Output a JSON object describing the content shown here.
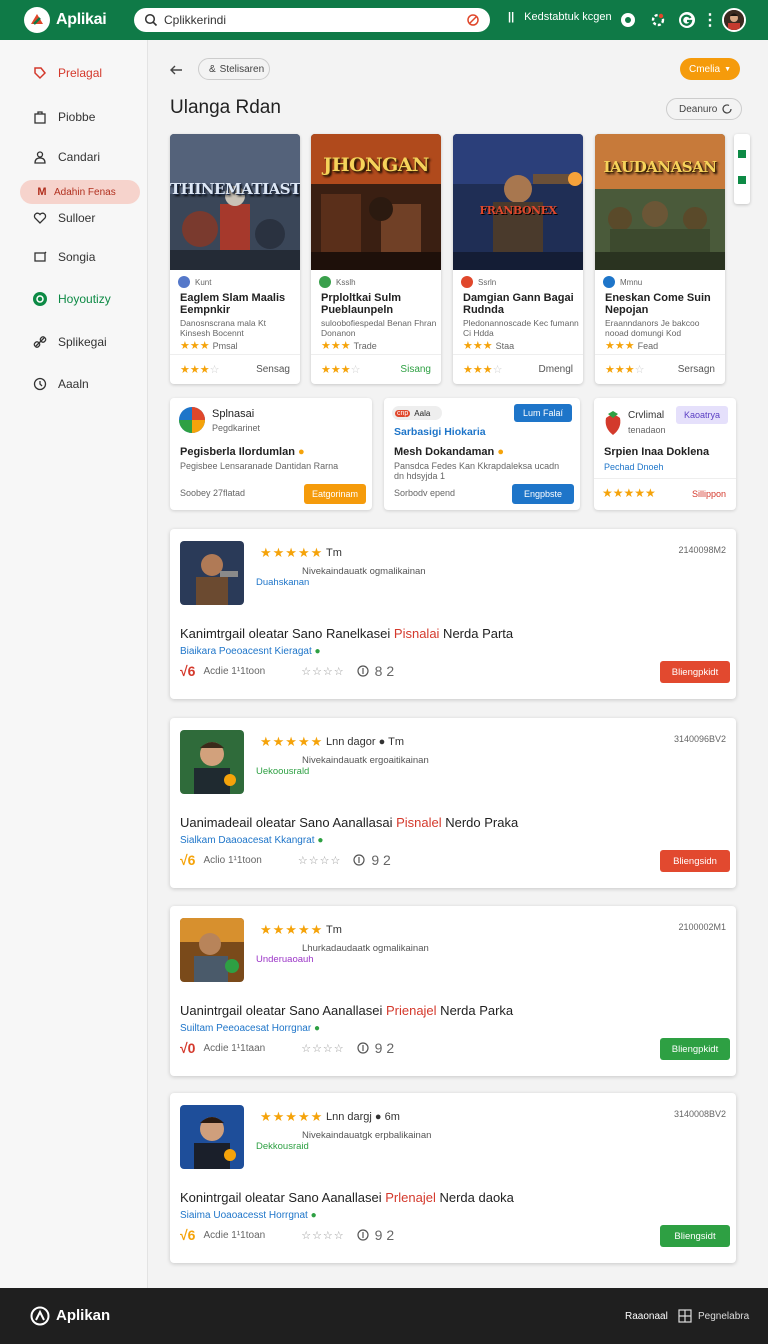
{
  "header": {
    "app_name": "Aplikai",
    "search_value": "Cplikkerindi",
    "account_text": "Kedstabtuk kcgen"
  },
  "sidebar": {
    "items": [
      {
        "label": "Prelagal",
        "icon": "tag-icon"
      },
      {
        "label": "Piobbe",
        "icon": "bag-icon"
      },
      {
        "label": "Candari",
        "icon": "person-icon"
      },
      {
        "label": "Adahin Fenas",
        "icon": "m-logo-icon"
      },
      {
        "label": "Sulloer",
        "icon": "heart-icon"
      },
      {
        "label": "Songia",
        "icon": "screen-icon"
      },
      {
        "label": "Hoyoutizy",
        "icon": "circle-icon"
      },
      {
        "label": "Splikegai",
        "icon": "link-icon"
      },
      {
        "label": "Aaaln",
        "icon": "clock-icon"
      }
    ]
  },
  "toolbar": {
    "chip_label": "Stelisaren",
    "orange_label": "Cmelia",
    "heading": "Ulanga Rdan",
    "sort_label": "Deanuro"
  },
  "games": [
    {
      "art": "THINEMATIAST",
      "dev": "Kunt",
      "name": "Eaglem Slam Maalis Eempnkir",
      "desc": "Danosnscrana mala Kt Kinsesh Bocennt",
      "rating_text": "Pmsal",
      "footer_label": "Sensag"
    },
    {
      "art": "JHONGAN",
      "dev": "Ksslh",
      "name": "Prploltkai Sulm Pueblaunpeln",
      "desc": "suloobofiespedal Benan Fhran Donanon",
      "rating_text": "Trade",
      "footer_label": "Sisang"
    },
    {
      "art": "FRANBONEX",
      "dev": "Ssrln",
      "name": "Damgian Gann Bagai Rudnda",
      "desc": "Pledonannoscade Kec fumann Ci Hdda",
      "rating_text": "Staa",
      "footer_label": "Dmengl"
    },
    {
      "art": "IAUDANASAN",
      "dev": "Mmnu",
      "name": "Eneskan Come Suin Nepojan",
      "desc": "Eraanndanors Je bakcoo nooad domungi Kod",
      "rating_text": "Fead",
      "footer_label": "Sersagn"
    }
  ],
  "promos": [
    {
      "title": "Splnasai",
      "sub": "Pegdkarinet",
      "name": "Pegisberla Ilordumlan",
      "desc": "Pegisbee Lensaranade Dantidan Rarna",
      "foot": "Soobey 27flatad",
      "button": "Eatgorinam"
    },
    {
      "badge": "Aala",
      "title": "Sarbasigi Hiokaria",
      "name": "Mesh Dokandaman",
      "desc": "Pansdca Fedes Kan Kkrapdaleksa ucadn dn hdsyjda 1",
      "foot": "Sorbodv epend",
      "button": "Engpbste",
      "corner_button": "Lum Falaí"
    },
    {
      "title": "Crvlimal",
      "sub": "tenadaon",
      "badge": "Kaoatrya",
      "name": "Srpien Inaa Doklena",
      "link": "Pechad Dnoeh",
      "foot": "Sillippon"
    }
  ],
  "reviews": [
    {
      "stars_after": "Tm",
      "date": "2140098M2",
      "sub": "Nivekaindauatk ogmalikainan",
      "tag": "Duahskanan",
      "title_a": "Kanimtrgail oleatar Sano Ranelkasei ",
      "title_red": "Pisnalai",
      "title_b": " Nerda Parta",
      "link": "Biaikara Poeoacesnt Kieragat",
      "lead": "√6",
      "age": "Acdie 1¹1toon",
      "count": "8 2",
      "button": "Bliengpkidt",
      "button_color": "#e2492f",
      "tag_color": "#1e75c9",
      "lead_color": "#d4392c"
    },
    {
      "stars_after": "Lnn dagor ● Tm",
      "date": "3140096BV2",
      "sub": "Nivekaindauatk ergoaitikainan",
      "tag": "Uekoousrald",
      "title_a": "Uanimadeail oleatar Sano Aanallasai ",
      "title_red": "Pisnalel",
      "title_b": " Nerdo Praka",
      "link": "Sialkam Daaoacesat Kkangrat",
      "lead": "√6",
      "age": "Aclio 1¹1toon",
      "count": "9 2",
      "button": "Bliengsidn",
      "button_color": "#e2492f",
      "tag_color": "#2ea043",
      "lead_color": "#f5a30a"
    },
    {
      "stars_after": "Tm",
      "date": "2100002M1",
      "sub": "Lhurkadaudaatk ogmalikainan",
      "tag": "Underuaoauh",
      "title_a": "Uanintrgail oleatar Sano Aanallasei ",
      "title_red": "Prienajel",
      "title_b": " Nerda Parka",
      "link": "Suiltam Peeoacesat Horrgnar",
      "lead": "√0",
      "age": "Acdie 1¹1taan",
      "count": "9 2",
      "button": "Bliengpkidt",
      "button_color": "#2ea043",
      "tag_color": "#9b35c7",
      "lead_color": "#d4392c"
    },
    {
      "stars_after": "Lnn dargj ● 6m",
      "date": "3140008BV2",
      "sub": "Nivekaindauatgk erpbalikainan",
      "tag": "Dekkousraid",
      "title_a": "Konintrgail oleatar Sano Aanallasei ",
      "title_red": "Prlenajel",
      "title_b": " Nerda daoka",
      "link": "Siaima Uoaoacesst Horrgnat",
      "lead": "√6",
      "age": "Acdie 1¹1toan",
      "count": "9 2",
      "button": "Bliengsidt",
      "button_color": "#2ea043",
      "tag_color": "#2ea043",
      "lead_color": "#f5a30a"
    }
  ],
  "footer": {
    "brand": "Aplikan",
    "link1": "Raaonaal",
    "link2": "Pegnelabra"
  }
}
